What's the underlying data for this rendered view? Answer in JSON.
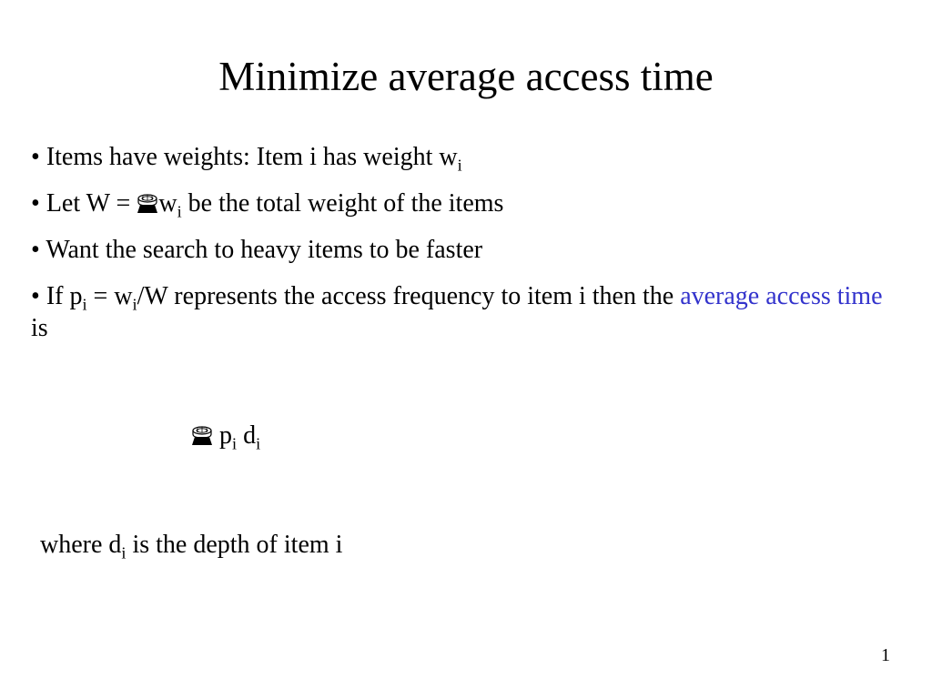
{
  "title": "Minimize average access time",
  "bullets": {
    "b1_pre": "Items have weights: Item i has weight w",
    "b1_sub": "i",
    "b2_pre": "Let W = ",
    "b2_post1": "w",
    "b2_sub": "i",
    "b2_post2": " be the total weight of the items",
    "b3": "Want the search to heavy items to be faster",
    "b4_pre": "If p",
    "b4_sub1": "i",
    "b4_mid1": " = w",
    "b4_sub2": "i",
    "b4_mid2": "/W  represents the access frequency to item i then the ",
    "b4_highlight": "average access time",
    "b4_after": " is"
  },
  "formula": {
    "p": " p",
    "sub1": "i",
    "space": "  d",
    "sub2": "i"
  },
  "where": {
    "pre": "where d",
    "sub": "i",
    "post": " is the depth of item i"
  },
  "page_number": "1"
}
